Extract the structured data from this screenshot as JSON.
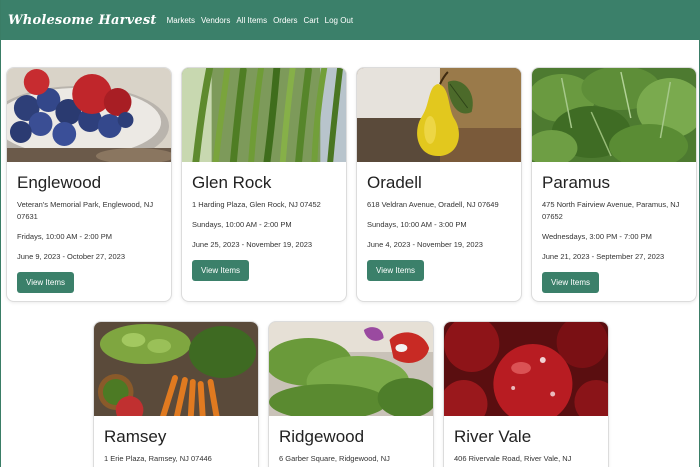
{
  "nav": {
    "brand": "Wholesome Harvest",
    "links": [
      "Markets",
      "Vendors",
      "All Items",
      "Orders",
      "Cart",
      "Log Out"
    ]
  },
  "markets": [
    {
      "name": "Englewood",
      "address": "Veteran's Memorial Park, Englewood, NJ 07631",
      "hours": "Fridays, 10:00 AM - 2:00 PM",
      "season": "June 9, 2023 - October 27, 2023",
      "button": "View Items",
      "image": "berries"
    },
    {
      "name": "Glen Rock",
      "address": "1 Harding Plaza, Glen Rock, NJ 07452",
      "hours": "Sundays, 10:00 AM - 2:00 PM",
      "season": "June 25, 2023 - November 19, 2023",
      "button": "View Items",
      "image": "green-beans"
    },
    {
      "name": "Oradell",
      "address": "618 Veldran Avenue, Oradell, NJ 07649",
      "hours": "Sundays, 10:00 AM - 3:00 PM",
      "season": "June 4, 2023 - November 19, 2023",
      "button": "View Items",
      "image": "pear"
    },
    {
      "name": "Paramus",
      "address": "475 North Fairview Avenue, Paramus, NJ 07652",
      "hours": "Wednesdays, 3:00 PM - 7:00 PM",
      "season": "June 21, 2023 - September 27, 2023",
      "button": "View Items",
      "image": "spinach"
    },
    {
      "name": "Ramsey",
      "address": "1 Erie Plaza, Ramsey, NJ 07446",
      "hours": "",
      "season": "",
      "button": "",
      "image": "vegetables"
    },
    {
      "name": "Ridgewood",
      "address": "6 Garber Square, Ridgewood, NJ",
      "hours": "",
      "season": "",
      "button": "",
      "image": "herbs"
    },
    {
      "name": "River Vale",
      "address": "406 Rivervale Road, River Vale, NJ",
      "hours": "",
      "season": "",
      "button": "",
      "image": "apples"
    }
  ]
}
